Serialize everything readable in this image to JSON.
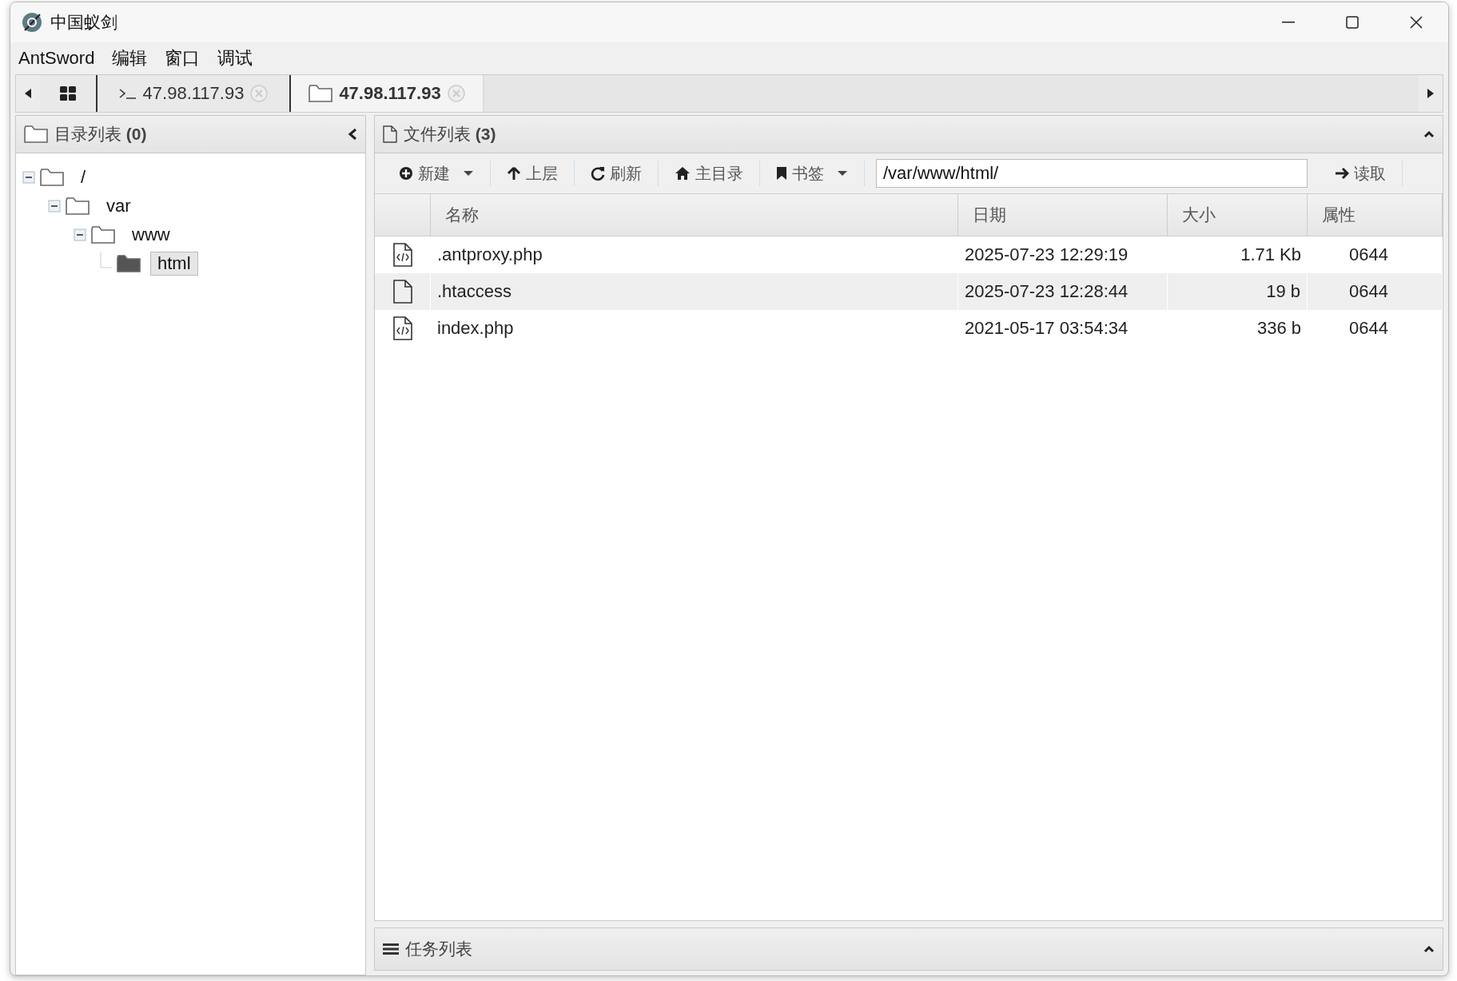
{
  "window": {
    "title": "中国蚁剑"
  },
  "menu": [
    "AntSword",
    "编辑",
    "窗口",
    "调试"
  ],
  "tabs": [
    {
      "kind": "home",
      "selected": false
    },
    {
      "kind": "terminal",
      "label": "47.98.117.93",
      "selected": false
    },
    {
      "kind": "folder",
      "label": "47.98.117.93",
      "selected": true
    }
  ],
  "dir_panel": {
    "title": "目录列表",
    "count": "(0)",
    "tree": [
      {
        "label": "/",
        "expanded": true,
        "selected": false,
        "children": [
          {
            "label": "var",
            "expanded": true,
            "selected": false,
            "children": [
              {
                "label": "www",
                "expanded": true,
                "selected": false,
                "children": [
                  {
                    "label": "html",
                    "selected": true
                  }
                ]
              }
            ]
          }
        ]
      }
    ]
  },
  "file_panel": {
    "title": "文件列表",
    "count": "(3)",
    "toolbar": [
      {
        "label": "新建",
        "dropdown": true
      },
      {
        "label": "上层",
        "dropdown": false
      },
      {
        "label": "刷新",
        "dropdown": false
      },
      {
        "label": "主目录",
        "dropdown": false
      },
      {
        "label": "书签",
        "dropdown": true
      }
    ],
    "path": "/var/www/html/",
    "read_button": "读取",
    "columns": [
      "名称",
      "日期",
      "大小",
      "属性"
    ],
    "rows": [
      {
        "kind": "code",
        "name": ".antproxy.php",
        "date": "2025-07-23 12:29:19",
        "size": "1.71 Kb",
        "mode": "0644",
        "selected": false
      },
      {
        "kind": "plain",
        "name": ".htaccess",
        "date": "2025-07-23 12:28:44",
        "size": "19 b",
        "mode": "0644",
        "selected": true
      },
      {
        "kind": "code",
        "name": "index.php",
        "date": "2021-05-17 03:54:34",
        "size": "336 b",
        "mode": "0644",
        "selected": false
      }
    ]
  },
  "task_panel": {
    "title": "任务列表"
  }
}
